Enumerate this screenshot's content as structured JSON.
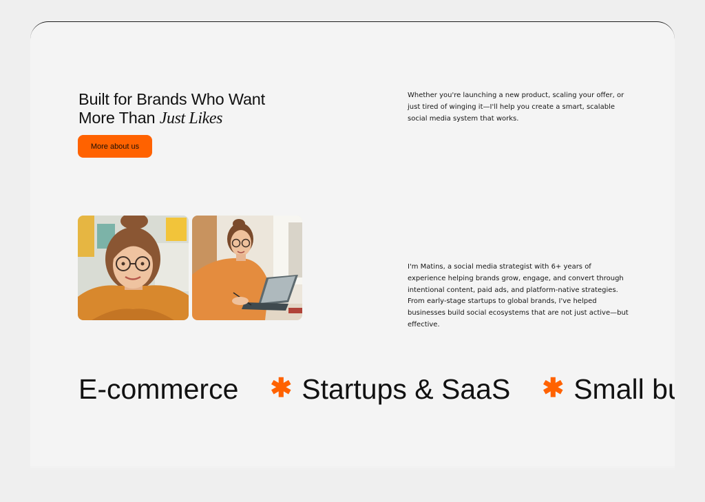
{
  "hero": {
    "title_line1": "Built for Brands Who Want",
    "title_line2": "More Than",
    "title_italic": "Just Likes",
    "cta_label": "More about us"
  },
  "intro": {
    "text": "Whether you're launching a new product, scaling your offer, or just tired of winging it—I'll help you create a smart, scalable social media system that works."
  },
  "about": {
    "text": "I'm Matins, a social media strategist with 6+ years of experience helping brands grow, engage, and convert through intentional content, paid ads, and platform-native strategies. From early-stage startups to global brands, I've helped businesses build social ecosystems that are not just active—but effective."
  },
  "photos": [
    {
      "subject": "woman-glasses-orange-sweater-portrait"
    },
    {
      "subject": "woman-glasses-working-on-tablet"
    }
  ],
  "ticker": {
    "items": [
      "E-commerce",
      "Startups & SaaS",
      "Small bu"
    ],
    "separator": "✱"
  },
  "colors": {
    "accent": "#ff6200",
    "card_bg": "#f4f4f4",
    "page_bg": "#efefef",
    "text": "#111111"
  }
}
